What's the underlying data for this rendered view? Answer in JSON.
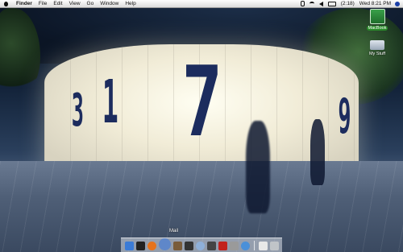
{
  "menubar": {
    "app_name": "Finder",
    "items": [
      "File",
      "Edit",
      "View",
      "Go",
      "Window",
      "Help"
    ],
    "status": {
      "battery": "(2:18)",
      "clock": "Wed 8:21 PM"
    }
  },
  "wallpaper": {
    "digits": [
      "3",
      "1",
      "7",
      "9"
    ]
  },
  "desktop_icons": [
    {
      "label": "MacBook",
      "icon": "hard-disk-icon",
      "selected": true
    },
    {
      "label": "My Stuff",
      "icon": "folder-icon",
      "selected": false
    }
  ],
  "dock": {
    "tooltip": "Mail",
    "items": [
      {
        "name": "finder-icon",
        "color": "#3b7bd6"
      },
      {
        "name": "dashboard-icon",
        "color": "#222222"
      },
      {
        "name": "firefox-icon",
        "color": "#e6731c"
      },
      {
        "name": "mail-icon",
        "color": "#5f87c9"
      },
      {
        "name": "address-book-icon",
        "color": "#7a5c3a"
      },
      {
        "name": "facetime-icon",
        "color": "#333333"
      },
      {
        "name": "itunes-icon",
        "color": "#8fb0d9"
      },
      {
        "name": "quicktime-icon",
        "color": "#444444"
      },
      {
        "name": "photo-booth-icon",
        "color": "#c2221e"
      },
      {
        "name": "preferences-icon",
        "color": "#9a9a9a"
      },
      {
        "name": "safari-icon",
        "color": "#4a90d9"
      },
      {
        "name": "document-icon",
        "color": "#e8e8e8"
      },
      {
        "name": "trash-icon",
        "color": "#c0c4c8"
      }
    ]
  }
}
